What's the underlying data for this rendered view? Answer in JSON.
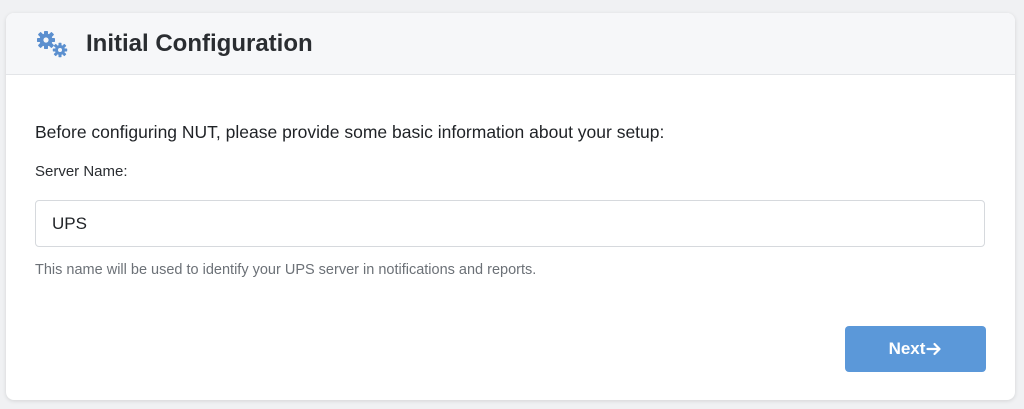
{
  "header": {
    "title": "Initial Configuration",
    "icon": "gears-icon",
    "icon_color": "#5b8fcf"
  },
  "form": {
    "intro": "Before configuring NUT, please provide some basic information about your setup:",
    "server_name_label": "Server Name:",
    "server_name_value": "UPS",
    "server_name_help": "This name will be used to identify your UPS server in notifications and reports."
  },
  "actions": {
    "next_label": "Next",
    "next_icon": "arrow-right-icon",
    "accent_color": "#5b98d9"
  }
}
